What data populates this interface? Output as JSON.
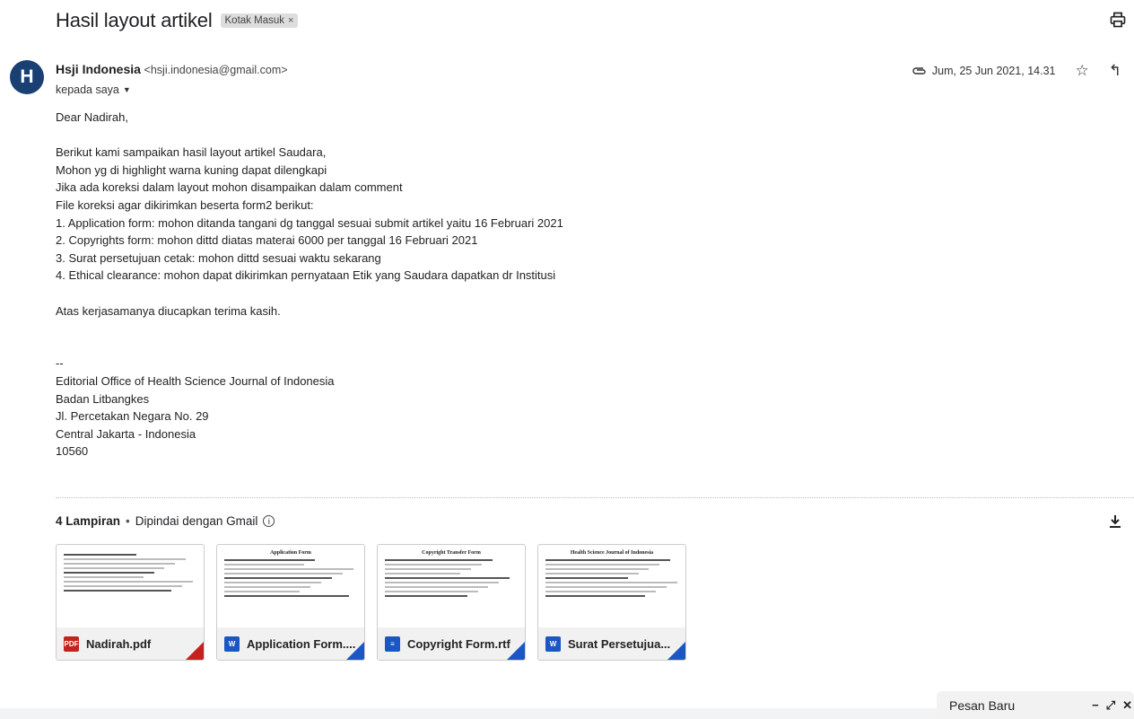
{
  "email": {
    "subject": "Hasil layout artikel",
    "label": "Kotak Masuk",
    "label_remove": "×",
    "sender": {
      "initial": "H",
      "name": "Hsji Indonesia",
      "email": "<hsji.indonesia@gmail.com>",
      "to": "kepada saya"
    },
    "date": "Jum, 25 Jun 2021, 14.31",
    "avatar_color": "#1a3f73",
    "body_lines": [
      "Dear Nadirah,",
      "",
      "Berikut kami sampaikan hasil layout artikel Saudara,",
      "Mohon yg di highlight warna kuning dapat dilengkapi",
      "Jika ada koreksi dalam layout mohon disampaikan dalam comment",
      "File koreksi agar dikirimkan beserta form2 berikut:",
      "1. Application form: mohon ditanda tangani dg tanggal sesuai submit artikel yaitu 16 Februari 2021",
      "2. Copyrights form: mohon dittd diatas materai 6000 per tanggal 16 Februari 2021",
      "3. Surat persetujuan cetak: mohon dittd sesuai waktu sekarang",
      "4. Ethical clearance: mohon dapat dikirimkan pernyataan Etik yang Saudara dapatkan dr Institusi",
      "",
      "Atas kerjasamanya diucapkan terima kasih.",
      "",
      "",
      "--",
      "Editorial Office of Health Science Journal of Indonesia",
      "Badan Litbangkes",
      "Jl. Percetakan Negara No. 29",
      "Central Jakarta - Indonesia",
      "10560"
    ]
  },
  "attachments": {
    "count_label": "4 Lampiran",
    "separator": "•",
    "scan_label": "Dipindai dengan Gmail",
    "info_glyph": "i",
    "items": [
      {
        "name": "Nadirah.pdf",
        "type": "PDF",
        "icon": "pdf-icon",
        "color": "#c5221f"
      },
      {
        "name": "Application Form....",
        "type": "W",
        "icon": "word-icon",
        "color": "#1a56c4"
      },
      {
        "name": "Copyright Form.rtf",
        "type": "≡",
        "icon": "doc-icon",
        "color": "#1a56c4"
      },
      {
        "name": "Surat Persetujua...",
        "type": "W",
        "icon": "word-icon",
        "color": "#1a56c4"
      }
    ],
    "thumb_titles": [
      "",
      "Application Form",
      "Copyright Transfer Form",
      "Health Science Journal of Indonesia"
    ]
  },
  "compose": {
    "title": "Pesan Baru",
    "minimize": "−",
    "expand": "⤢",
    "close": "✕"
  },
  "icons": {
    "star": "☆",
    "reply": "↰",
    "caret": "▼"
  }
}
